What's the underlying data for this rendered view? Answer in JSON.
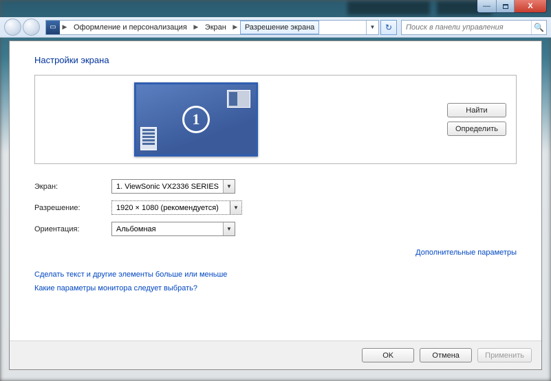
{
  "caption": {
    "min": "—",
    "close": "X"
  },
  "breadcrumb": {
    "seg1": "Оформление и персонализация",
    "seg2": "Экран",
    "seg3": "Разрешение экрана"
  },
  "search": {
    "placeholder": "Поиск в панели управления"
  },
  "title": "Настройки экрана",
  "preview_number": "1",
  "sidebtn": {
    "find": "Найти",
    "detect": "Определить"
  },
  "form": {
    "screen_label": "Экран:",
    "screen_value": "1. ViewSonic VX2336 SERIES",
    "res_label": "Разрешение:",
    "res_value": "1920 × 1080 (рекомендуется)",
    "orient_label": "Ориентация:",
    "orient_value": "Альбомная"
  },
  "links": {
    "advanced": "Дополнительные параметры",
    "scale": "Сделать текст и другие элементы больше или меньше",
    "which": "Какие параметры монитора следует выбрать?"
  },
  "footer": {
    "ok": "OK",
    "cancel": "Отмена",
    "apply": "Применить"
  }
}
